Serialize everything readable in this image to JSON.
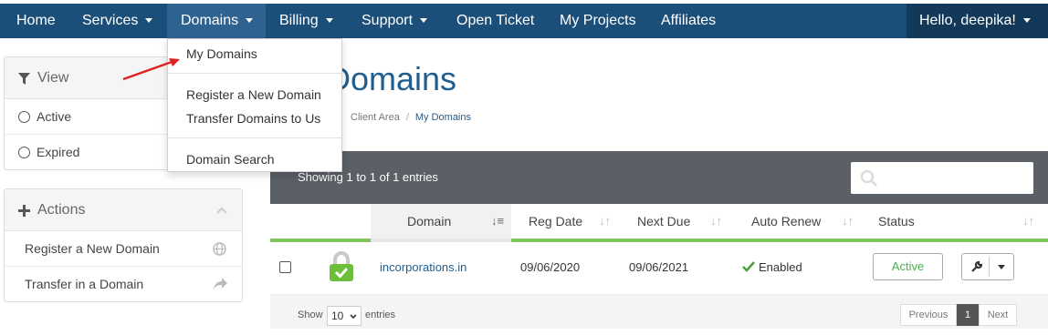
{
  "nav": {
    "home": "Home",
    "services": "Services",
    "domains": "Domains",
    "billing": "Billing",
    "support": "Support",
    "open_ticket": "Open Ticket",
    "my_projects": "My Projects",
    "affiliates": "Affiliates",
    "user": "Hello, deepika!",
    "bar_color": "#1b4f7a"
  },
  "domains_menu": {
    "my_domains": "My Domains",
    "register": "Register a New Domain",
    "transfer": "Transfer Domains to Us",
    "search": "Domain Search"
  },
  "sidebar": {
    "view_title": "View",
    "active": "Active",
    "expired": "Expired",
    "actions_title": "Actions",
    "register": "Register a New Domain",
    "transfer": "Transfer in a Domain"
  },
  "main": {
    "title": "Domains",
    "breadcrumb": {
      "client_area": "Client Area",
      "current": "My Domains"
    },
    "showing": "Showing 1 to 1 of 1 entries",
    "columns": [
      "Domain",
      "Reg Date",
      "Next Due",
      "Auto Renew",
      "Status"
    ],
    "rows": [
      {
        "domain": "incorporations.in",
        "reg_date": "09/06/2020",
        "next_due": "09/06/2021",
        "auto_renew": "Enabled",
        "status": "Active"
      }
    ],
    "footer": {
      "show": "Show",
      "page_size": "10",
      "entries": "entries",
      "previous": "Previous",
      "page": "1",
      "next": "Next"
    }
  },
  "colors": {
    "accent_green": "#7ec65a",
    "status_green": "#4cae4c",
    "title_blue": "#1f5e8f"
  }
}
